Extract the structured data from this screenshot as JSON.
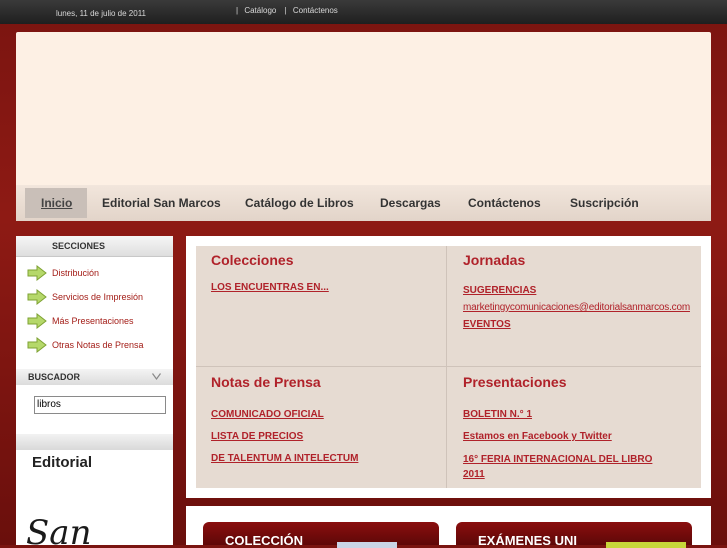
{
  "topbar": {
    "date": "lunes, 11 de julio de 2011",
    "separator": "|",
    "links": [
      "Catálogo",
      "Contáctenos"
    ]
  },
  "nav": {
    "items": [
      "Inicio",
      "Editorial San Marcos",
      "Catálogo de Libros",
      "Descargas",
      "Contáctenos",
      "Suscripción"
    ],
    "active": "Inicio"
  },
  "sidebar": {
    "secciones_title": "SECCIONES",
    "items": [
      "Distribución",
      "Servicios de Impresión",
      "Más Presentaciones",
      "Otras Notas de Prensa"
    ],
    "buscador_title": "BUSCADOR",
    "search_value": "libros",
    "editorial_title": "Editorial",
    "logo_text": "San"
  },
  "main": {
    "colecciones": {
      "title": "Colecciones",
      "links": [
        "LOS ENCUENTRAS EN..."
      ]
    },
    "jornadas": {
      "title": "Jornadas",
      "links": [
        "SUGERENCIAS",
        "marketingycomunicaciones@editorialsanmarcos.com",
        "EVENTOS"
      ]
    },
    "notas": {
      "title": "Notas de Prensa",
      "links": [
        "COMUNICADO OFICIAL",
        "LISTA DE PRECIOS",
        "DE TALENTUM A INTELECTUM"
      ]
    },
    "presentaciones": {
      "title": "Presentaciones",
      "links": [
        "BOLETIN N.° 1",
        "Estamos en Facebook y Twitter",
        "16° FERIA INTERNACIONAL DEL LIBRO 2011"
      ]
    }
  },
  "bottom": {
    "tile1": "COLECCIÓN",
    "tile2": "EXÁMENES UNI"
  },
  "colors": {
    "accent": "#b0222a",
    "background": "#7a1410",
    "topbar": "#2a2a2a"
  }
}
